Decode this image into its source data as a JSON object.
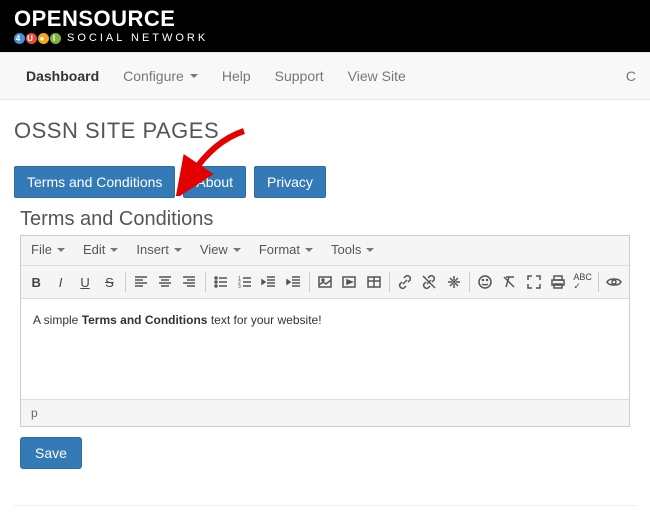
{
  "brand": {
    "name": "OPENSOURCE",
    "sub": "SOCIAL NETWORK"
  },
  "nav": {
    "items": [
      {
        "label": "Dashboard",
        "active": true,
        "caret": false
      },
      {
        "label": "Configure",
        "active": false,
        "caret": true
      },
      {
        "label": "Help",
        "active": false,
        "caret": false
      },
      {
        "label": "Support",
        "active": false,
        "caret": false
      },
      {
        "label": "View Site",
        "active": false,
        "caret": false
      }
    ],
    "right_partial": "C"
  },
  "page": {
    "title": "OSSN SITE PAGES",
    "tabs": [
      {
        "label": "Terms and Conditions"
      },
      {
        "label": "About"
      },
      {
        "label": "Privacy"
      }
    ],
    "section_heading": "Terms and Conditions"
  },
  "editor": {
    "menus": [
      "File",
      "Edit",
      "Insert",
      "View",
      "Format",
      "Tools"
    ],
    "toolbar_icons": [
      "bold-icon",
      "italic-icon",
      "underline-icon",
      "strike-icon",
      "align-left-icon",
      "align-center-icon",
      "align-right-icon",
      "bullet-list-icon",
      "number-list-icon",
      "outdent-icon",
      "indent-icon",
      "image-icon",
      "media-icon",
      "table-icon",
      "link-icon",
      "unlink-icon",
      "anchor-icon",
      "emoji-icon",
      "clear-format-icon",
      "fullscreen-icon",
      "print-icon",
      "spellcheck-icon",
      "preview-icon"
    ],
    "content_prefix": "A simple ",
    "content_bold": "Terms and Conditions",
    "content_suffix": " text for your website!",
    "status_path": "p"
  },
  "actions": {
    "save_label": "Save"
  }
}
